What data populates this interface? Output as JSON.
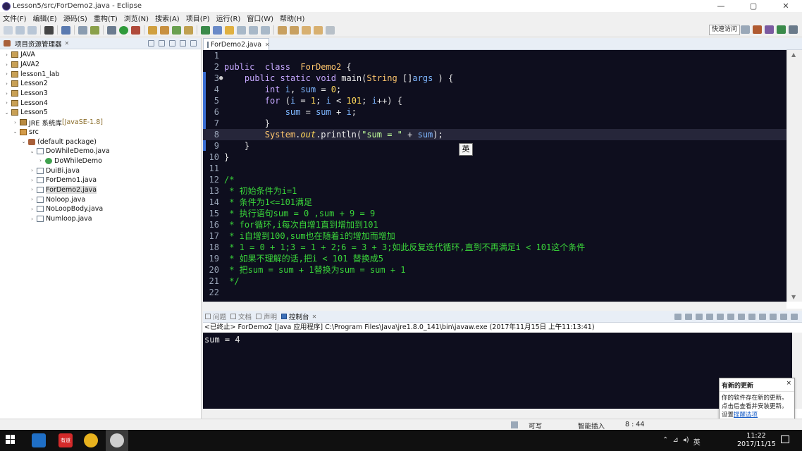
{
  "window": {
    "title": "Lesson5/src/ForDemo2.java - Eclipse",
    "controls": [
      "—",
      "▢",
      "✕"
    ]
  },
  "menu": [
    "文件(F)",
    "编辑(E)",
    "源码(S)",
    "重构(T)",
    "浏览(N)",
    "搜索(A)",
    "项目(P)",
    "运行(R)",
    "窗口(W)",
    "帮助(H)"
  ],
  "toolbar": {
    "quick_access": "快速访问"
  },
  "explorer": {
    "title": "项目资源管理器",
    "items": [
      {
        "label": "JAVA",
        "toggle": "›",
        "depth": 0,
        "icon": "project-icon"
      },
      {
        "label": "JAVA2",
        "toggle": "›",
        "depth": 0,
        "icon": "project-icon"
      },
      {
        "label": "lesson1_lab",
        "toggle": "›",
        "depth": 0,
        "icon": "project-icon"
      },
      {
        "label": "Lesson2",
        "toggle": "›",
        "depth": 0,
        "icon": "project-icon"
      },
      {
        "label": "Lesson3",
        "toggle": "›",
        "depth": 0,
        "icon": "project-icon"
      },
      {
        "label": "Lesson4",
        "toggle": "›",
        "depth": 0,
        "icon": "project-icon"
      },
      {
        "label": "Lesson5",
        "toggle": "⌄",
        "depth": 0,
        "icon": "project-icon"
      },
      {
        "label": "JRE 系统库",
        "decoration": " [JavaSE-1.8]",
        "toggle": "›",
        "depth": 1,
        "icon": "library-icon"
      },
      {
        "label": "src",
        "toggle": "⌄",
        "depth": 1,
        "icon": "source-folder-icon"
      },
      {
        "label": "(default package)",
        "toggle": "⌄",
        "depth": 2,
        "icon": "package-icon"
      },
      {
        "label": "DoWhileDemo.java",
        "toggle": "⌄",
        "depth": 3,
        "icon": "java-file-icon"
      },
      {
        "label": "DoWhileDemo",
        "toggle": "›",
        "depth": 4,
        "icon": "class-icon"
      },
      {
        "label": "DuiBi.java",
        "toggle": "›",
        "depth": 3,
        "icon": "java-file-icon"
      },
      {
        "label": "ForDemo1.java",
        "toggle": "›",
        "depth": 3,
        "icon": "java-file-icon"
      },
      {
        "label": "ForDemo2.java",
        "toggle": "›",
        "depth": 3,
        "icon": "java-file-icon",
        "selected": true
      },
      {
        "label": "Noloop.java",
        "toggle": "›",
        "depth": 3,
        "icon": "java-file-icon"
      },
      {
        "label": "NoLoopBody.java",
        "toggle": "›",
        "depth": 3,
        "icon": "java-file-icon"
      },
      {
        "label": "Numloop.java",
        "toggle": "›",
        "depth": 3,
        "icon": "java-file-icon"
      }
    ]
  },
  "editor": {
    "tab_label": "ForDemo2.java",
    "current_line": 8,
    "lines": [
      {
        "n": "1",
        "tokens": []
      },
      {
        "n": "2",
        "tokens": [
          [
            "kw",
            "public"
          ],
          [
            "",
            "  "
          ],
          [
            "kw",
            "class"
          ],
          [
            "",
            "  "
          ],
          [
            "cls",
            "ForDemo2"
          ],
          [
            "",
            " {"
          ]
        ]
      },
      {
        "n": "3",
        "bp": "●",
        "tokens": [
          [
            "",
            "    "
          ],
          [
            "kw",
            "public"
          ],
          [
            "",
            " "
          ],
          [
            "kw",
            "static"
          ],
          [
            "",
            " "
          ],
          [
            "kw",
            "void"
          ],
          [
            "",
            " main("
          ],
          [
            "cls",
            "String"
          ],
          [
            "",
            " []"
          ],
          [
            "var",
            "args"
          ],
          [
            "",
            " ) {"
          ]
        ]
      },
      {
        "n": "4",
        "tokens": [
          [
            "",
            "        "
          ],
          [
            "kw",
            "int"
          ],
          [
            "",
            " "
          ],
          [
            "var",
            "i"
          ],
          [
            "",
            ", "
          ],
          [
            "var",
            "sum"
          ],
          [
            "",
            " = "
          ],
          [
            "num",
            "0"
          ],
          [
            "",
            ";"
          ]
        ]
      },
      {
        "n": "5",
        "tokens": [
          [
            "",
            "        "
          ],
          [
            "kw",
            "for"
          ],
          [
            "",
            " ("
          ],
          [
            "var",
            "i"
          ],
          [
            "",
            " = "
          ],
          [
            "num",
            "1"
          ],
          [
            "",
            "; "
          ],
          [
            "var",
            "i"
          ],
          [
            "",
            " < "
          ],
          [
            "num",
            "101"
          ],
          [
            "",
            "; "
          ],
          [
            "var",
            "i"
          ],
          [
            "",
            "++) {"
          ]
        ]
      },
      {
        "n": "6",
        "tokens": [
          [
            "",
            "            "
          ],
          [
            "var",
            "sum"
          ],
          [
            "",
            " = "
          ],
          [
            "var",
            "sum"
          ],
          [
            "",
            " + "
          ],
          [
            "var",
            "i"
          ],
          [
            "",
            ";"
          ]
        ]
      },
      {
        "n": "7",
        "tokens": [
          [
            "",
            "        }"
          ]
        ]
      },
      {
        "n": "8",
        "tokens": [
          [
            "",
            "        "
          ],
          [
            "cls",
            "System"
          ],
          [
            "",
            "."
          ],
          [
            "fld",
            "out"
          ],
          [
            "",
            ".println("
          ],
          [
            "str",
            "\"sum = \""
          ],
          [
            "",
            " + "
          ],
          [
            "var",
            "sum"
          ],
          [
            "",
            ");"
          ]
        ]
      },
      {
        "n": "9",
        "tokens": [
          [
            "",
            "    }"
          ]
        ]
      },
      {
        "n": "10",
        "tokens": [
          [
            "",
            "}"
          ]
        ]
      },
      {
        "n": "11",
        "tokens": []
      },
      {
        "n": "12",
        "tokens": [
          [
            "cmt",
            "/*"
          ]
        ]
      },
      {
        "n": "13",
        "tokens": [
          [
            "cmt",
            " * 初始条件为i=1"
          ]
        ]
      },
      {
        "n": "14",
        "tokens": [
          [
            "cmt",
            " * 条件为1<=101满足"
          ]
        ]
      },
      {
        "n": "15",
        "tokens": [
          [
            "cmt",
            " * 执行语句sum = 0 ,sum + 9 = 9"
          ]
        ]
      },
      {
        "n": "16",
        "tokens": [
          [
            "cmt",
            " * for循环,i每次自增1直到增加到101"
          ]
        ]
      },
      {
        "n": "17",
        "tokens": [
          [
            "cmt",
            " * i自增到100,sum也在随着i的增加而增加"
          ]
        ]
      },
      {
        "n": "18",
        "tokens": [
          [
            "cmt",
            " * 1 = 0 + 1;3 = 1 + 2;6 = 3 + 3;如此反复迭代循环,直到不再满足i < 101这个条件"
          ]
        ]
      },
      {
        "n": "19",
        "tokens": [
          [
            "cmt",
            " * 如果不理解的话,把i < 101 替换成5"
          ]
        ]
      },
      {
        "n": "20",
        "tokens": [
          [
            "cmt",
            " * 把sum = sum + 1替换为sum = sum + 1"
          ]
        ]
      },
      {
        "n": "21",
        "tokens": [
          [
            "cmt",
            " */"
          ]
        ]
      },
      {
        "n": "22",
        "tokens": []
      }
    ],
    "ime_tooltip": "英"
  },
  "console": {
    "tabs": [
      {
        "label": "问题",
        "active": false
      },
      {
        "label": "文档",
        "active": false
      },
      {
        "label": "声明",
        "active": false
      },
      {
        "label": "控制台",
        "active": true
      }
    ],
    "status": "<已终止> ForDemo2 [Java 应用程序] C:\\Program Files\\Java\\jre1.8.0_141\\bin\\javaw.exe  (2017年11月15日 上午11:13:41)",
    "output": "sum = 4"
  },
  "notification": {
    "title": "有新的更新",
    "close": "×",
    "body_line1": "你的软件存在新的更新。",
    "body_line2": "点击后查看并安装更新。",
    "setting_prefix": "设置",
    "setting_link": "提醒选项"
  },
  "status_bar": {
    "writable": "可写",
    "insert_mode": "智能插入",
    "position": "8 : 44"
  },
  "taskbar": {
    "ime": "英",
    "time": "11:22",
    "date": "2017/11/15",
    "apps": [
      {
        "name": "app-blue-icon",
        "color": "#1f6fc6"
      },
      {
        "name": "app-red-icon",
        "color": "#d42a2a",
        "label": "有道"
      },
      {
        "name": "chrome-icon",
        "color": "#e8b21e"
      },
      {
        "name": "eclipse-icon",
        "color": "#cfcfcf"
      }
    ]
  }
}
